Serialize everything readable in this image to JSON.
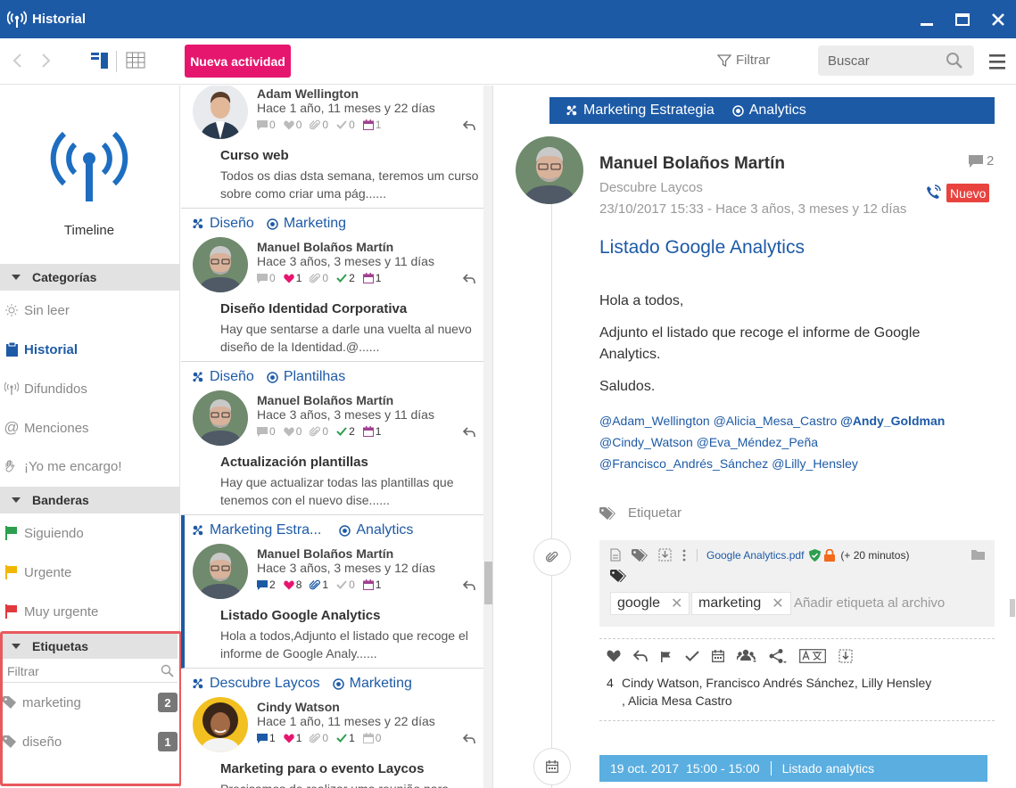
{
  "window": {
    "title": "Historial"
  },
  "toolbar": {
    "new_activity_label": "Nueva actividad",
    "filter_label": "Filtrar",
    "search_placeholder": "Buscar"
  },
  "sidebar": {
    "logo_caption": "Timeline",
    "categories_header": "Categorías",
    "categories": [
      {
        "label": "Sin leer",
        "icon": "sun-icon"
      },
      {
        "label": "Historial",
        "icon": "clipboard-icon",
        "active": true
      },
      {
        "label": "Difundidos",
        "icon": "broadcast-icon"
      },
      {
        "label": "Menciones",
        "icon": "at-icon"
      },
      {
        "label": "¡Yo me encargo!",
        "icon": "hand-icon"
      }
    ],
    "flags_header": "Banderas",
    "flags": [
      {
        "label": "Siguiendo",
        "color": "#2e9e4f"
      },
      {
        "label": "Urgente",
        "color": "#f2b705"
      },
      {
        "label": "Muy urgente",
        "color": "#e0393e"
      }
    ],
    "tags_header": "Etiquetas",
    "tags_filter_placeholder": "Filtrar",
    "tags": [
      {
        "label": "marketing",
        "count": "2"
      },
      {
        "label": "diseño",
        "count": "1"
      }
    ]
  },
  "feed": [
    {
      "category": "",
      "subcategory": "",
      "author": "Adam Wellington",
      "time": "Hace 1 año, 11 meses y 22 días",
      "stats": {
        "comments": "0",
        "likes": "0",
        "attachments": "0",
        "checks": "0",
        "events": "1"
      },
      "subject": "Curso web",
      "preview": " Todos os dias dsta semana, teremos um curso sobre como criar uma pág......"
    },
    {
      "category": "Diseño",
      "subcategory": "Marketing",
      "author": "Manuel Bolaños Martín",
      "time": "Hace 3 años, 3 meses y 11 días",
      "stats": {
        "comments": "0",
        "likes": "1",
        "attachments": "0",
        "checks": "2",
        "events": "1"
      },
      "subject": "Diseño Identidad Corporativa",
      "preview": "Hay que sentarse a darle una vuelta al nuevo diseño de la Identidad.@......"
    },
    {
      "category": "Diseño",
      "subcategory": "Plantilhas",
      "author": "Manuel Bolaños Martín",
      "time": "Hace 3 años, 3 meses y 11 días",
      "stats": {
        "comments": "0",
        "likes": "0",
        "attachments": "0",
        "checks": "2",
        "events": "1"
      },
      "subject": "Actualización plantillas",
      "preview": "Hay que actualizar todas las plantillas que tenemos con el nuevo dise......"
    },
    {
      "category": "Marketing Estra...",
      "subcategory": "Analytics",
      "author": "Manuel Bolaños Martín",
      "time": "Hace 3 años, 3 meses y 12 días",
      "stats": {
        "comments": "2",
        "likes": "8",
        "attachments": "1",
        "checks": "0",
        "events": "1"
      },
      "subject": "Listado Google Analytics",
      "preview": "Hola a todos,Adjunto el listado que recoge el informe de Google Analy......"
    },
    {
      "category": "Descubre Laycos",
      "subcategory": "Marketing",
      "author": "Cindy Watson",
      "time": "Hace 1 año, 11 meses y 22 días",
      "stats": {
        "comments": "1",
        "likes": "1",
        "attachments": "0",
        "checks": "1",
        "events": "0"
      },
      "subject": "Marketing para o evento Laycos",
      "preview": "Precisamos de realizar uma reunião para tratar"
    }
  ],
  "detail": {
    "category": "Marketing Estrategia",
    "subcategory": "Analytics",
    "author": "Manuel Bolaños Martín",
    "company": "Descubre Laycos",
    "date": "23/10/2017 15:33 - Hace 3 años, 3 meses y 12 días",
    "comment_count": "2",
    "badge": "Nuevo",
    "subject": "Listado Google Analytics",
    "body": [
      "Hola a todos,",
      "Adjunto el listado que recoge el informe de Google Analytics.",
      "Saludos."
    ],
    "mentions_line1": "@Adam_Wellington @Alicia_Mesa_Castro ",
    "mentions_bold": "@Andy_Goldman",
    "mentions_line2": "@Cindy_Watson @Eva_Méndez_Peña",
    "mentions_line3": "@Francisco_Andrés_Sánchez @Lilly_Hensley",
    "tag_label": "Etiquetar",
    "attachment": {
      "file_name": "Google Analytics.pdf",
      "time_note": "(+ 20 minutos)",
      "tags": [
        "google",
        "marketing"
      ],
      "tag_placeholder": "Añadir etiqueta al archivo"
    },
    "recipients_count": "4",
    "recipients_line1": "Cindy Watson, Francisco Andrés Sánchez, Lilly Hensley",
    "recipients_line2": ", Alicia Mesa Castro",
    "event": {
      "date": "19 oct. 2017",
      "time": "15:00 - 15:00",
      "title": "Listado analytics"
    }
  },
  "colors": {
    "brand": "#1d5aa6",
    "accent": "#e6166f",
    "badge": "#e8433f",
    "highlight_border": "#e8595d",
    "event": "#5aaee0"
  }
}
